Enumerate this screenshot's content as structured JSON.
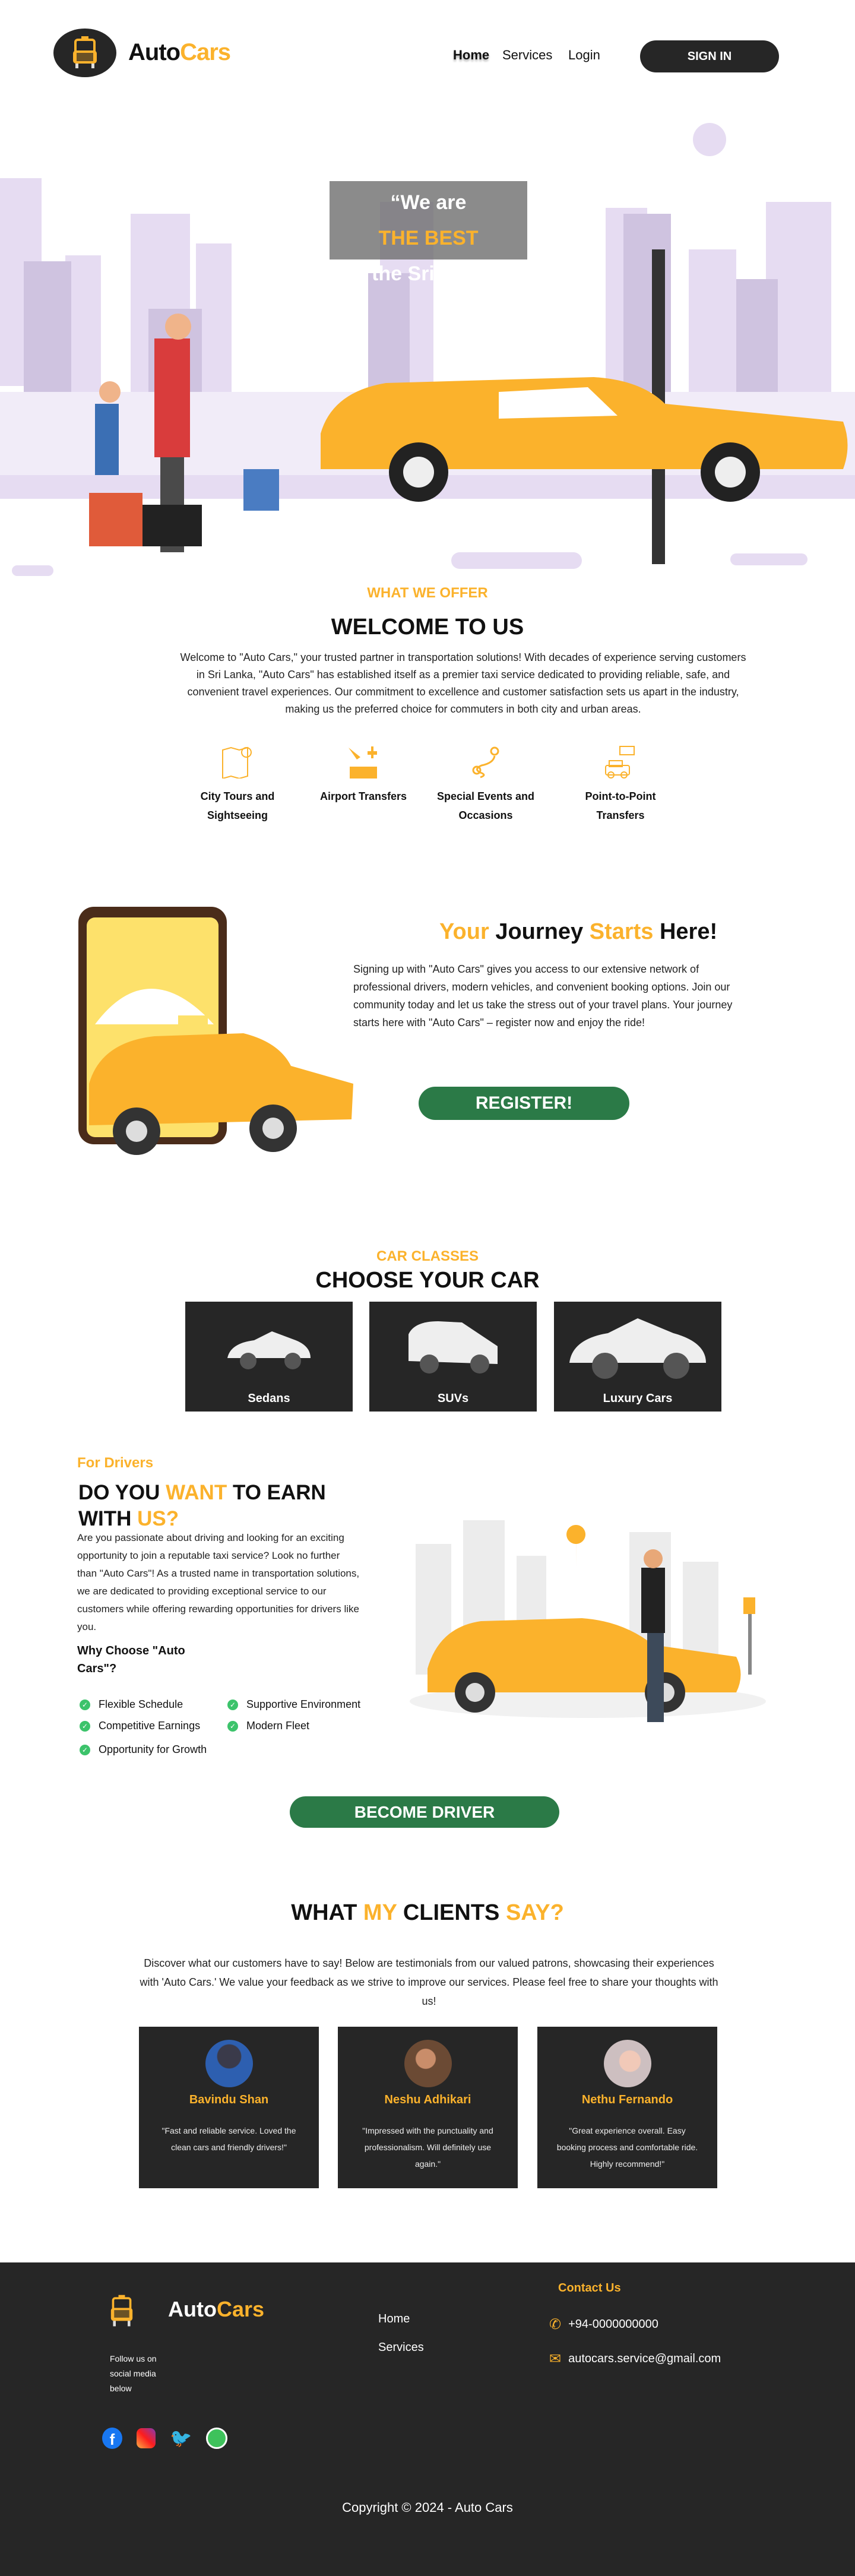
{
  "header": {
    "brand_a": "Auto",
    "brand_b": "Cars",
    "nav": [
      "Home",
      "Services",
      "Login"
    ],
    "sign_in": "SIGN IN"
  },
  "hero": {
    "line1": "“We are",
    "line2": "THE BEST",
    "line3": "in the Sri Lanka”"
  },
  "offer": {
    "label": "WHAT WE OFFER",
    "title": "WELCOME TO US",
    "text": "Welcome to \"Auto Cars,\" your trusted partner in transportation solutions! With decades of experience serving customers in Sri Lanka, \"Auto Cars\" has established itself as a premier taxi service dedicated to providing reliable, safe, and convenient travel experiences. Our commitment to excellence and customer satisfaction sets us apart in the industry, making us the preferred choice for commuters in both city and urban areas.",
    "services": [
      {
        "label": "City Tours and Sightseeing",
        "icon": "map-icon"
      },
      {
        "label": "Airport Transfers",
        "icon": "airport-icon"
      },
      {
        "label": "Special Events and Occasions",
        "icon": "route-icon"
      },
      {
        "label": "Point-to-Point Transfers",
        "icon": "taxi-icon"
      }
    ]
  },
  "journey": {
    "t1": "Your",
    "t2": "Journey",
    "t3": "Starts",
    "t4": "Here!",
    "text": "Signing up with \"Auto Cars\" gives you access to our extensive network of professional drivers, modern vehicles, and convenient booking options. Join our community today and let us take the stress out of your travel plans. Your journey starts here with \"Auto Cars\" – register now and enjoy the ride!",
    "button": "REGISTER!"
  },
  "cars": {
    "label": "CAR CLASSES",
    "title": "CHOOSE YOUR CAR",
    "items": [
      "Sedans",
      "SUVs",
      "Luxury Cars"
    ]
  },
  "drivers": {
    "label": "For Drivers",
    "h1": "DO YOU",
    "h2": "WANT",
    "h3": "TO EARN",
    "h4": "WITH",
    "h5": "US?",
    "text": "Are you passionate about driving and looking for an exciting opportunity to join a reputable taxi service? Look no further than \"Auto Cars\"! As a trusted name in transportation solutions, we are dedicated to providing exceptional service to our customers while offering rewarding opportunities for drivers like you.",
    "why": "Why Choose \"Auto Cars\"?",
    "features": [
      "Flexible Schedule",
      "Supportive Environment",
      "Competitive Earnings",
      "Modern Fleet",
      "Opportunity for Growth"
    ],
    "button": "BECOME DRIVER"
  },
  "clients": {
    "t1": "WHAT",
    "t2": "MY",
    "t3": "CLIENTS",
    "t4": "SAY?",
    "text": "Discover what our customers have to say! Below are testimonials from our valued patrons, showcasing their experiences with 'Auto Cars.' We value your feedback as we strive to improve our services. Please feel free to share your thoughts with us!",
    "items": [
      {
        "name": "Bavindu Shan",
        "quote": "\"Fast and reliable service. Loved the clean cars and friendly drivers!\""
      },
      {
        "name": "Neshu Adhikari",
        "quote": "\"Impressed with the punctuality and professionalism. Will definitely use again.\""
      },
      {
        "name": "Nethu Fernando",
        "quote": "\"Great experience overall. Easy booking process and comfortable ride. Highly recommend!\""
      }
    ]
  },
  "footer": {
    "brand_a": "Auto",
    "brand_b": "Cars",
    "follow": "Follow us on social media below",
    "links": [
      "Home",
      "Services"
    ],
    "contact_title": "Contact Us",
    "phone": "+94-0000000000",
    "email": "autocars.service@gmail.com",
    "copyright": "Copyright © 2024 - Auto Cars"
  },
  "colors": {
    "accent": "#fbb22c",
    "dark": "#262626",
    "green": "#2b7a47"
  }
}
